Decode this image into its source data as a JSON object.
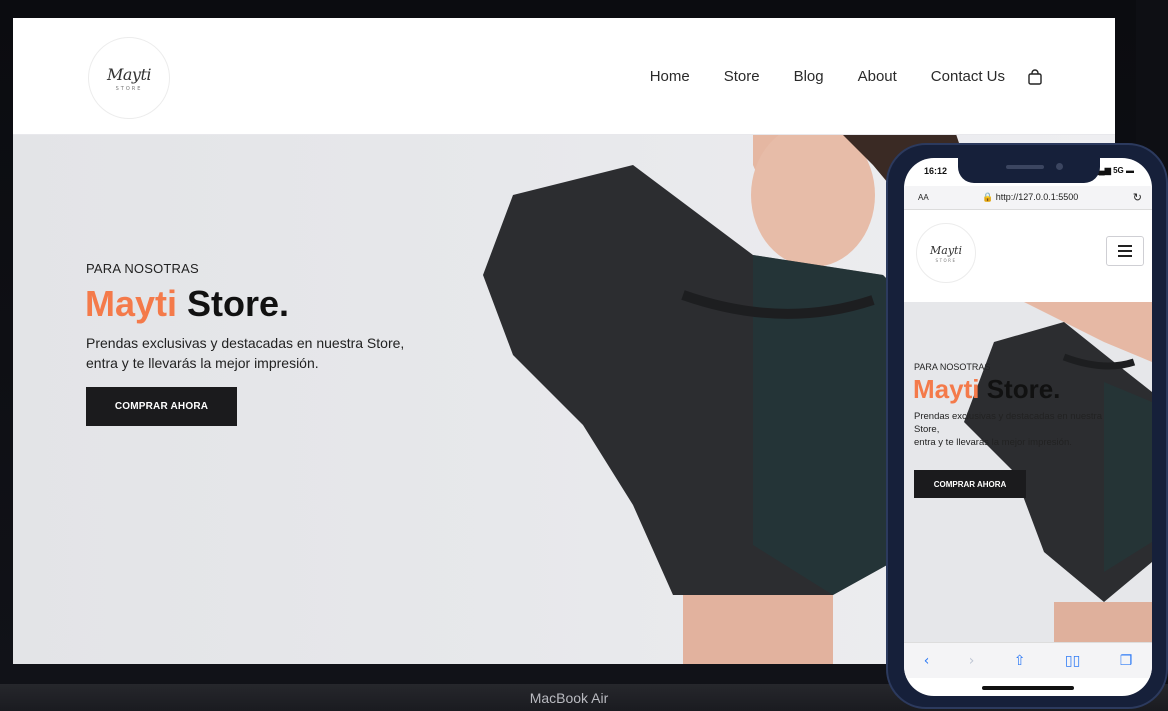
{
  "laptop": {
    "device_label": "MacBook Air"
  },
  "site": {
    "logo": {
      "script": "Mayti",
      "sub": "STORE"
    },
    "nav": [
      "Home",
      "Store",
      "Blog",
      "About",
      "Contact Us"
    ],
    "hero": {
      "eyebrow": "PARA NOSOTRAS",
      "title_accent": "Mayti",
      "title_rest": " Store.",
      "text_lines": [
        "Prendas exclusivas y destacadas en nuestra Store,",
        "entra y te llevarás la mejor impresión."
      ],
      "cta": "COMPRAR AHORA"
    }
  },
  "phone": {
    "status": {
      "time": "16:12",
      "network": "5G"
    },
    "url_bar": {
      "aa": "AA",
      "url": "http://127.0.0.1:5500"
    },
    "hero_text_lines": [
      "Prendas exclusivas y destacadas en nuestra",
      "Store,",
      "entra y te llevarás la mejor impresión."
    ]
  },
  "colors": {
    "accent": "#f47a4a",
    "button": "#1b1b1d",
    "phone_frame": "#16203a",
    "safari_blue": "#2f7bf5"
  }
}
